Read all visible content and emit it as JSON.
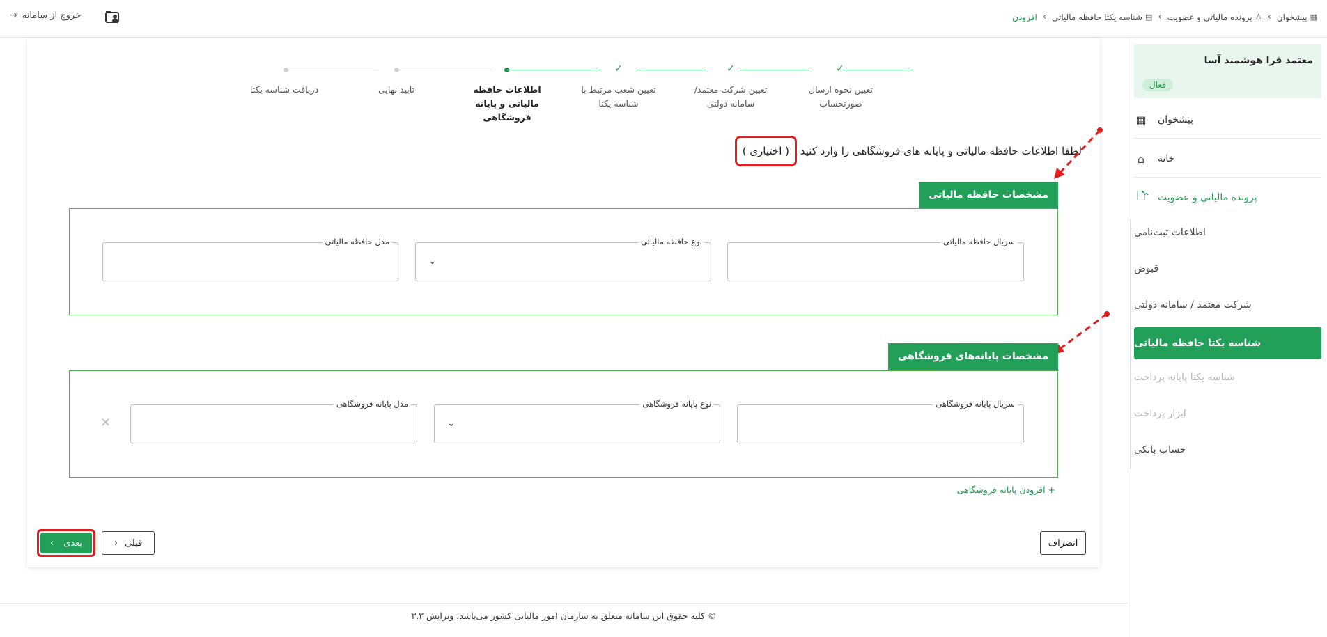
{
  "topbar": {
    "logout_label": "خروج از سامانه",
    "breadcrumb": [
      {
        "label": "پیشخوان",
        "icon": "dashboard-icon"
      },
      {
        "label": "پرونده مالیاتی و عضویت",
        "icon": "user-icon"
      },
      {
        "label": "شناسه یکتا حافظه مالیاتی",
        "icon": "document-icon"
      },
      {
        "label": "افزودن"
      }
    ]
  },
  "sidebar": {
    "company_name": "معتمد فرا هوشمند آسا",
    "status": "فعال",
    "nav": [
      {
        "label": "پیشخوان",
        "icon": "dashboard-icon"
      },
      {
        "label": "خانه",
        "icon": "home-icon"
      },
      {
        "label": "پرونده مالیاتی و عضویت",
        "icon": "file-icon"
      }
    ],
    "sub_items": [
      {
        "label": "اطلاعات ثبت‌نامی"
      },
      {
        "label": "قبوض"
      },
      {
        "label": "شرکت معتمد / سامانه دولتی"
      },
      {
        "label": "شناسه یکتا حافظه مالیاتی"
      },
      {
        "label": "شناسه یکتا پایانه پرداخت"
      },
      {
        "label": "ابزار پرداخت"
      },
      {
        "label": "حساب بانکی"
      }
    ]
  },
  "stepper": {
    "steps": [
      {
        "label": "تعیین نحوه ارسال صورتحساب",
        "status": "done"
      },
      {
        "label": "تعیین شرکت معتمد/سامانه دولتی",
        "status": "done"
      },
      {
        "label": "تعیین شعب مرتبط با شناسه یکتا",
        "status": "done"
      },
      {
        "label": "اطلاعات حافظه مالیاتی و پایانه فروشگاهی",
        "status": "current"
      },
      {
        "label": "تایید نهایی",
        "status": "pending"
      },
      {
        "label": "دریافت شناسه یکتا",
        "status": "pending"
      }
    ]
  },
  "form": {
    "instruction": "لطفا اطلاعات حافظه مالیاتی و پایانه های فروشگاهی را وارد کنید",
    "optional_label": "( اختیاری )",
    "memory_section": {
      "title": "مشخصات حافظه مالیاتی",
      "serial_label": "سریال حافظه مالیاتی",
      "type_label": "نوع حافظه مالیاتی",
      "model_label": "مدل حافظه مالیاتی"
    },
    "terminal_section": {
      "title": "مشخصات پایانه‌های فروشگاهی",
      "serial_label": "سریال پایانه فروشگاهی",
      "type_label": "نوع پایانه فروشگاهی",
      "model_label": "مدل پایانه فروشگاهی"
    },
    "add_terminal_label": "+ افزودن پایانه فروشگاهی"
  },
  "actions": {
    "cancel_label": "انصراف",
    "prev_label": "قبلی",
    "next_label": "بعدی"
  },
  "footer": {
    "text": "© کلیه حقوق این سامانه متعلق به سازمان امور مالیاتی کشور می‌باشد. ویرایش ۳.۳"
  },
  "colors": {
    "accent": "#22a05a",
    "highlight": "#e02020"
  }
}
